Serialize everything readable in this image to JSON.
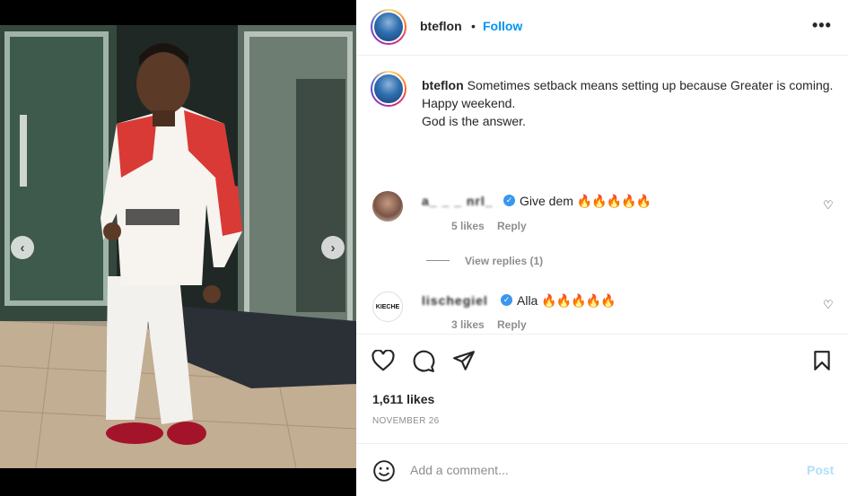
{
  "post": {
    "username": "bteflon",
    "follow_label": "Follow",
    "separator": "•",
    "more_label": "•••",
    "caption_lines": [
      "Sometimes setback means setting up because Greater is coming.",
      "Happy weekend.",
      "God is the answer."
    ],
    "likes": "1,611 likes",
    "date": "NOVEMBER 26"
  },
  "media": {
    "prev_label": "‹",
    "next_label": "›"
  },
  "comments": [
    {
      "username": "a_ _ _ nrl_",
      "text": "Give dem",
      "emoji": "🔥🔥🔥🔥🔥",
      "likes": "5 likes",
      "reply_label": "Reply",
      "view_replies": "View replies (1)"
    },
    {
      "username": "lischegiel",
      "text": "Alla",
      "emoji": "🔥🔥🔥🔥🔥",
      "likes": "3 likes",
      "reply_label": "Reply",
      "avatar_text": "KIECHE"
    }
  ],
  "composer": {
    "placeholder": "Add a comment...",
    "post_label": "Post"
  },
  "colors": {
    "accent": "#0095f6",
    "post_disabled": "#b2dffc",
    "verified": "#3897f0"
  }
}
